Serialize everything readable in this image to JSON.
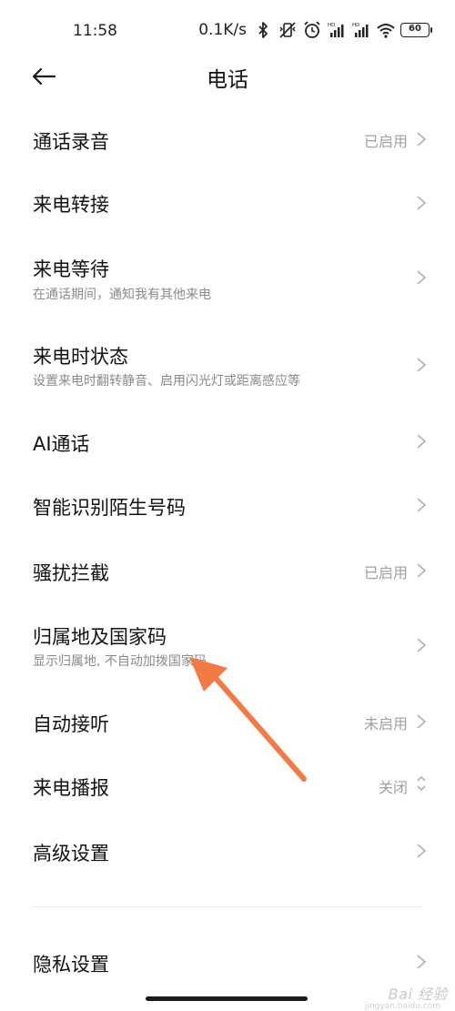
{
  "status_bar": {
    "time": "11:58",
    "net_speed": "0.1K/s",
    "battery": "60"
  },
  "header": {
    "title": "电话"
  },
  "settings": [
    {
      "title": "通话录音",
      "value": "已启用"
    },
    {
      "title": "来电转接"
    },
    {
      "title": "来电等待",
      "subtitle": "在通话期间，通知我有其他来电"
    },
    {
      "title": "来电时状态",
      "subtitle": "设置来电时翻转静音、启用闪光灯或距离感应等"
    },
    {
      "title": "AI通话"
    },
    {
      "title": "智能识别陌生号码"
    },
    {
      "title": "骚扰拦截",
      "value": "已启用"
    },
    {
      "title": "归属地及国家码",
      "subtitle": "显示归属地, 不自动加拨国家码"
    },
    {
      "title": "自动接听",
      "value": "未启用"
    },
    {
      "title": "来电播报",
      "value": "关闭"
    },
    {
      "title": "高级设置"
    },
    {
      "title": "隐私设置"
    }
  ],
  "annotation": {
    "arrow_color": "#f47a45"
  },
  "watermark": {
    "text": "Bai 经验",
    "sub": "jingyan.baidu.com"
  }
}
